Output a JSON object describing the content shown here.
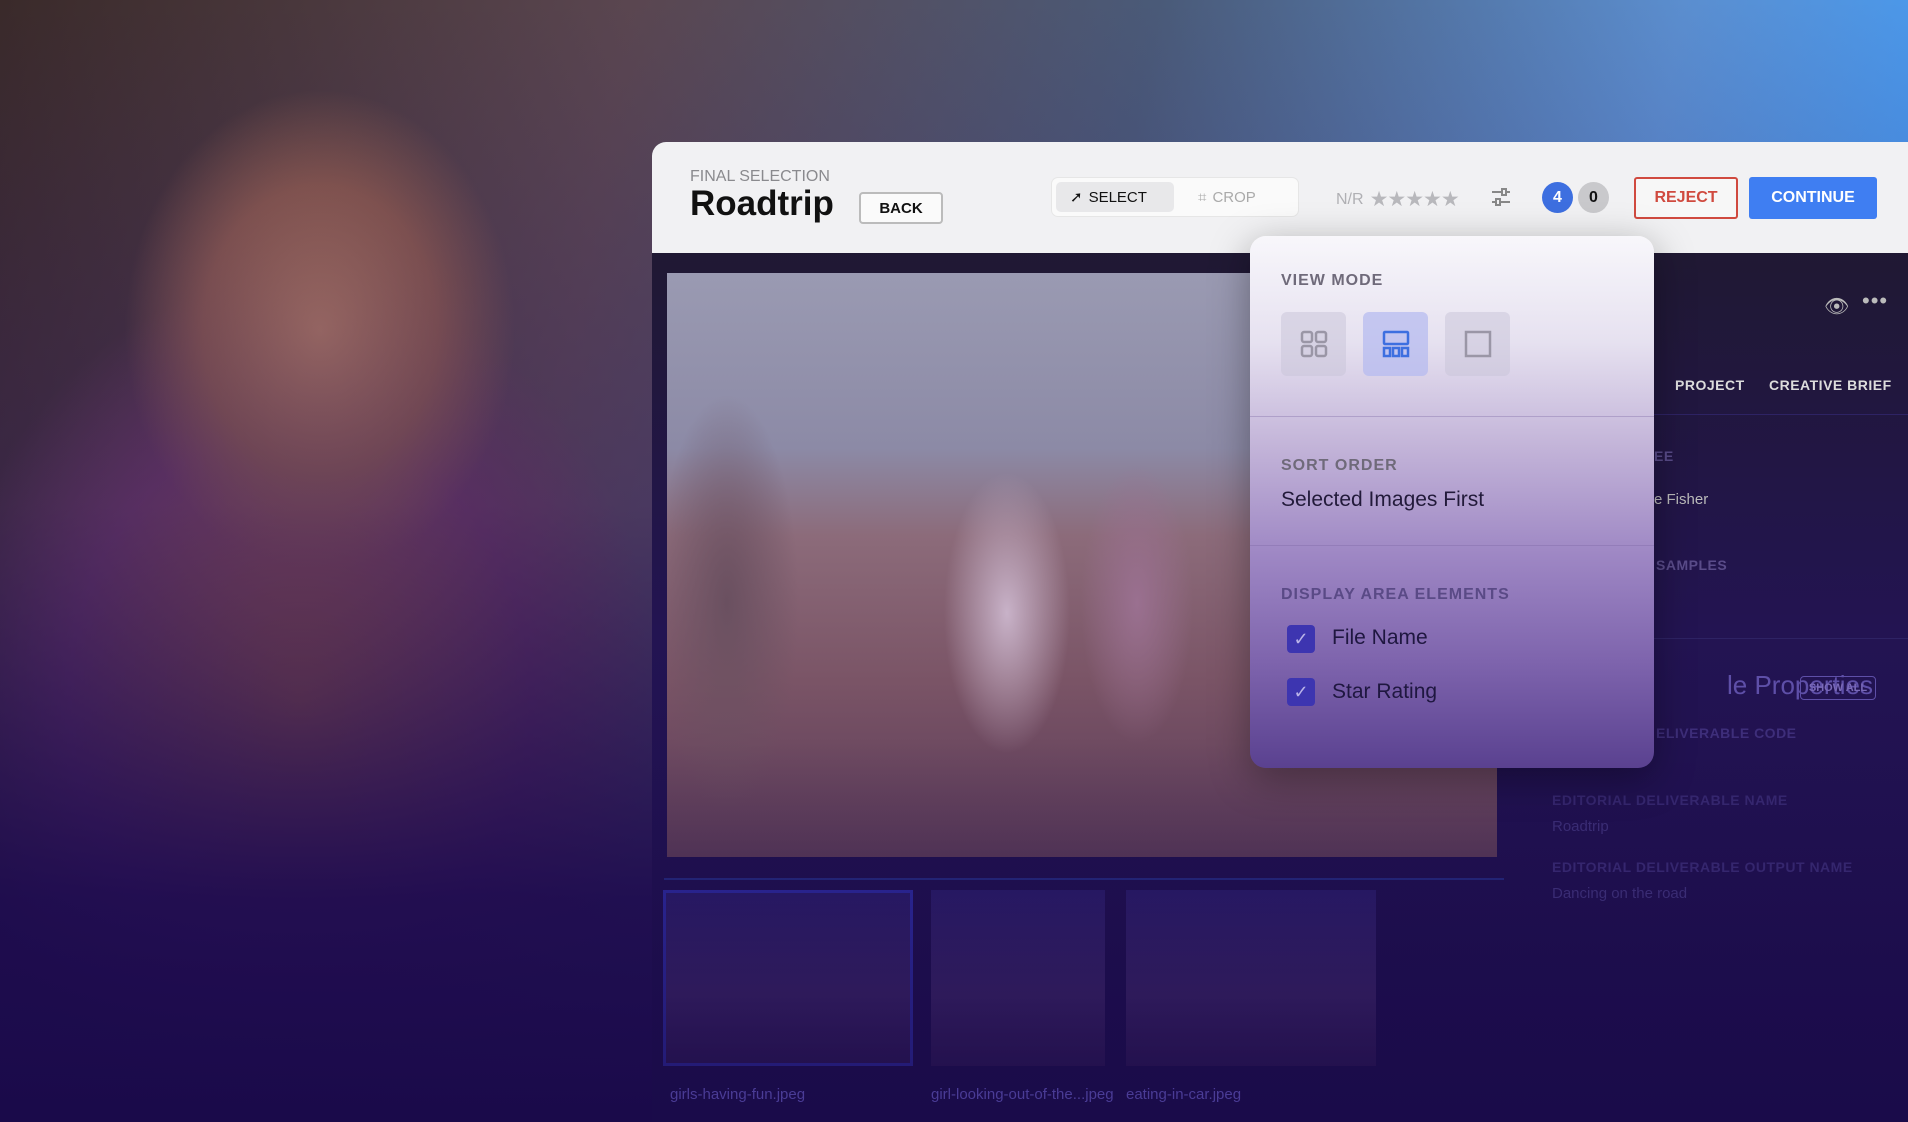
{
  "header": {
    "eyebrow": "FINAL SELECTION",
    "title": "Roadtrip",
    "back_label": "BACK",
    "tools": [
      {
        "label": "SELECT",
        "icon": "cursor-icon",
        "active": true
      },
      {
        "label": "CROP",
        "icon": "crop-icon",
        "active": false
      }
    ],
    "rating_label": "N/R",
    "rating_stars": 0,
    "rating_max": 5,
    "selected_count": "4",
    "rejected_count": "0",
    "reject_label": "REJECT",
    "continue_label": "CONTINUE"
  },
  "colors": {
    "accent": "#3f7ef2",
    "reject": "#d04a3f",
    "checkbox": "#3d35b0"
  },
  "thumbnails": [
    {
      "file_name": "girls-having-fun.jpeg",
      "selected": true
    },
    {
      "file_name": "girl-looking-out-of-the...jpeg",
      "selected": false
    },
    {
      "file_name": "eating-in-car.jpeg",
      "selected": false
    }
  ],
  "right_panel": {
    "tabs": [
      "PROJECT",
      "CREATIVE BRIEF"
    ],
    "assignee_label_fragment": "EE",
    "assignee_value_fragment": "e Fisher",
    "samples_label_fragment": "SAMPLES",
    "properties_title_fragment": "le Properties",
    "show_all_label": "SHOW ALL",
    "code_label_fragment": "ELIVERABLE CODE",
    "fields": [
      {
        "label": "EDITORIAL DELIVERABLE NAME",
        "value": "Roadtrip"
      },
      {
        "label": "EDITORIAL DELIVERABLE OUTPUT NAME",
        "value": "Dancing on the road"
      }
    ]
  },
  "view_menu": {
    "view_mode_label": "VIEW MODE",
    "view_modes": [
      {
        "icon": "grid-icon",
        "active": false
      },
      {
        "icon": "filmstrip-icon",
        "active": true
      },
      {
        "icon": "single-view-icon",
        "active": false
      }
    ],
    "sort_order_label": "SORT ORDER",
    "sort_order_value": "Selected Images First",
    "display_label": "DISPLAY AREA ELEMENTS",
    "display_elements": [
      {
        "label": "File Name",
        "checked": true
      },
      {
        "label": "Star Rating",
        "checked": true
      }
    ]
  }
}
